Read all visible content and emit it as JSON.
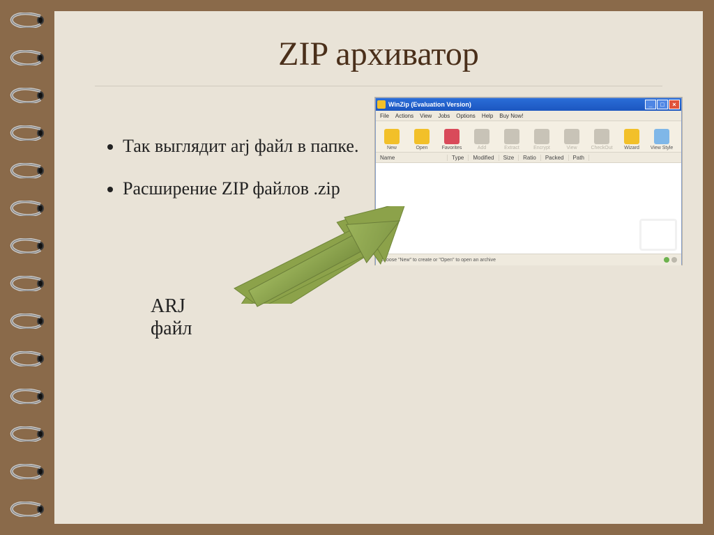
{
  "slide": {
    "title": "ZIP архиватор",
    "bullets": [
      "Так выглядит arj файл в папке.",
      "Расширение ZIP файлов .zip"
    ],
    "arj_label": "ARJ\nфайл"
  },
  "winzip": {
    "title": "WinZip (Evaluation Version)",
    "menu": [
      "File",
      "Actions",
      "View",
      "Jobs",
      "Options",
      "Help",
      "Buy Now!"
    ],
    "toolbar": [
      {
        "label": "New",
        "color": "#f2c029",
        "disabled": false
      },
      {
        "label": "Open",
        "color": "#f2c029",
        "disabled": false
      },
      {
        "label": "Favorites",
        "color": "#d94a5a",
        "disabled": false
      },
      {
        "label": "Add",
        "color": "#c8c3b7",
        "disabled": true
      },
      {
        "label": "Extract",
        "color": "#c8c3b7",
        "disabled": true
      },
      {
        "label": "Encrypt",
        "color": "#c8c3b7",
        "disabled": true
      },
      {
        "label": "View",
        "color": "#c8c3b7",
        "disabled": true
      },
      {
        "label": "CheckOut",
        "color": "#c8c3b7",
        "disabled": true
      },
      {
        "label": "Wizard",
        "color": "#f2c029",
        "disabled": false
      },
      {
        "label": "View Style",
        "color": "#7fb7e8",
        "disabled": false
      }
    ],
    "columns": [
      "Name",
      "Type",
      "Modified",
      "Size",
      "Ratio",
      "Packed",
      "Path"
    ],
    "status": "Choose \"New\" to create or \"Open\" to open an archive",
    "leds": [
      "#6db24e",
      "#bdb9ad"
    ]
  }
}
